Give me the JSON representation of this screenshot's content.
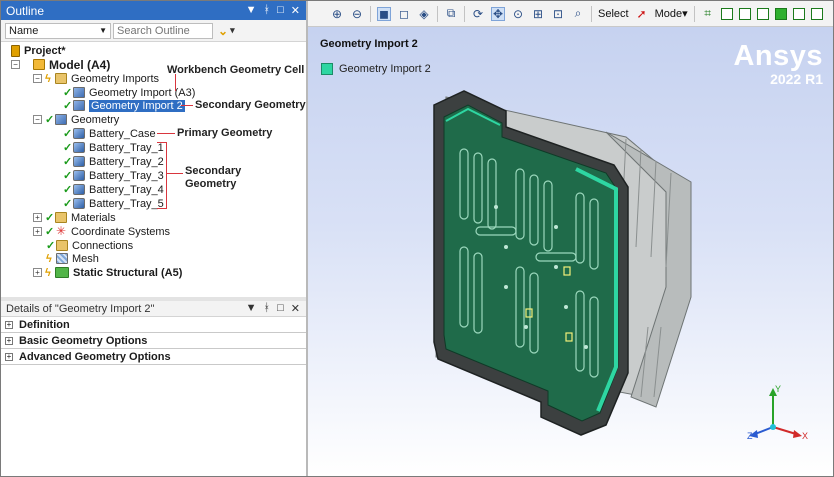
{
  "outline": {
    "title": "Outline",
    "controls": [
      "▼",
      "ᚼ",
      "□",
      "✕"
    ],
    "name_selector": "Name",
    "search_placeholder": "Search Outline",
    "tree": {
      "project": "Project*",
      "model": "Model (A4)",
      "geometry_imports": "Geometry Imports",
      "geometry_import_a3": "Geometry Import (A3)",
      "geometry_import_2": "Geometry Import 2",
      "geometry": "Geometry",
      "battery_case": "Battery_Case",
      "trays": [
        "Battery_Tray_1",
        "Battery_Tray_2",
        "Battery_Tray_3",
        "Battery_Tray_4",
        "Battery_Tray_5"
      ],
      "materials": "Materials",
      "coordinate_systems": "Coordinate Systems",
      "connections": "Connections",
      "mesh": "Mesh",
      "static_structural": "Static Structural (A5)"
    },
    "annotations": {
      "workbench": "Workbench Geometry Cell",
      "secondary_single": "Secondary Geometry",
      "primary": "Primary Geometry",
      "secondary_group_line1": "Secondary",
      "secondary_group_line2": "Geometry"
    }
  },
  "details": {
    "title": "Details of \"Geometry Import 2\"",
    "controls": [
      "▼",
      "ᚼ",
      "□",
      "✕"
    ],
    "sections": [
      "Definition",
      "Basic Geometry Options",
      "Advanced Geometry Options"
    ]
  },
  "viewport_toolbar": {
    "select_label": "Select",
    "mode_label": "Mode▾"
  },
  "viewport": {
    "title": "Geometry Import 2",
    "legend_label": "Geometry Import 2",
    "legend_color": "#2ed6a2",
    "brand_name": "Ansys",
    "brand_version": "2022 R1",
    "axes": {
      "x": "X",
      "y": "Y",
      "z": "Z"
    }
  },
  "colors": {
    "accent": "#2f6ec3",
    "annotation_line": "#d9363e",
    "plate_green": "#1f6b4a",
    "check_green": "#1a9a1a"
  }
}
